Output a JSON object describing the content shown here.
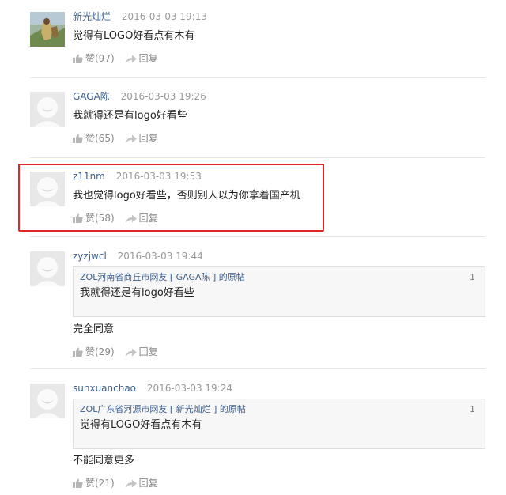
{
  "comments": [
    {
      "username": "新光灿烂",
      "time": "2016-03-03 19:13",
      "text": "觉得有LOGO好看点有木有",
      "like_label": "赞(97)",
      "reply_label": "回复",
      "avatar": "photo-avatar"
    },
    {
      "username": "GAGA陈",
      "time": "2016-03-03 19:26",
      "text": "我就得还是有logo好看些",
      "like_label": "赞(65)",
      "reply_label": "回复",
      "avatar": "default-avatar"
    },
    {
      "username": "z11nm",
      "time": "2016-03-03 19:53",
      "text": "我也觉得logo好看些，否则别人以为你拿着国产机",
      "like_label": "赞(58)",
      "reply_label": "回复",
      "avatar": "default-avatar",
      "highlighted": true
    },
    {
      "username": "zyzjwcl",
      "time": "2016-03-03 19:44",
      "quote": {
        "header": "ZOL河南省商丘市网友 [ GAGA陈 ] 的原帖",
        "floor": "1",
        "text": "我就得还是有logo好看些"
      },
      "text": "完全同意",
      "like_label": "赞(29)",
      "reply_label": "回复",
      "avatar": "default-avatar"
    },
    {
      "username": "sunxuanchao",
      "time": "2016-03-03 19:24",
      "quote": {
        "header": "ZOL广东省河源市网友 [ 新光灿烂 ] 的原帖",
        "floor": "1",
        "text": "觉得有LOGO好看点有木有"
      },
      "text": "不能同意更多",
      "like_label": "赞(21)",
      "reply_label": "回复",
      "avatar": "default-avatar"
    }
  ],
  "colors": {
    "username": "#3b5e8c",
    "highlight": "#e0242a",
    "meta": "#999999"
  }
}
